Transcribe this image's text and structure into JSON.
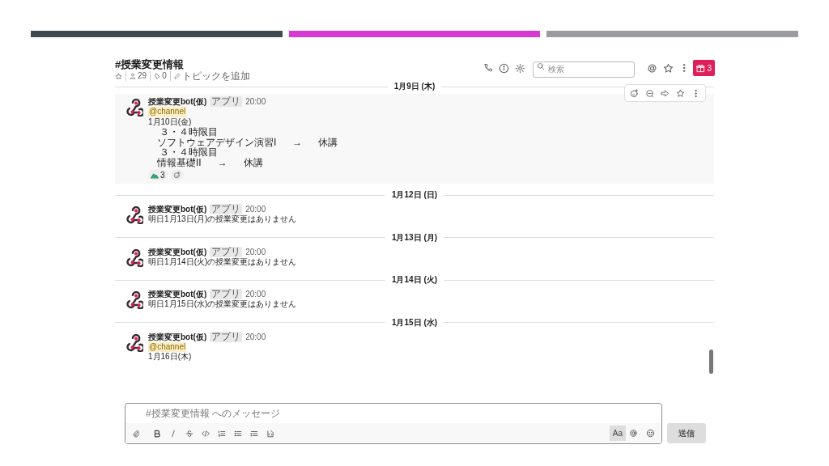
{
  "channel": {
    "name": "#授業変更情報",
    "member_count": "29",
    "pin_count": "0",
    "topic_action": "トピックを追加"
  },
  "search": {
    "placeholder": "検索"
  },
  "gift_badge": "3",
  "days": [
    {
      "date": "1月9日 (木)",
      "messages": [
        {
          "sender": "授業変更bot(仮)",
          "badge": "アプリ",
          "time": "20:00",
          "hovered": true,
          "lines": [
            {
              "kind": "mention",
              "text": "@channel"
            },
            {
              "kind": "text",
              "text": "1月10日(金)"
            },
            {
              "kind": "indent",
              "text": " ３・４時限目"
            },
            {
              "kind": "indent",
              "text": "ソフトウェアデザイン演習I      →      休講"
            },
            {
              "kind": "indent",
              "text": " ３・４時限目"
            },
            {
              "kind": "indent",
              "text": "情報基礎II      →      休講"
            }
          ],
          "reactions": [
            {
              "count": "3"
            }
          ]
        }
      ]
    },
    {
      "date": "1月12日 (日)",
      "messages": [
        {
          "sender": "授業変更bot(仮)",
          "badge": "アプリ",
          "time": "20:00",
          "hovered": false,
          "lines": [
            {
              "kind": "text",
              "text": "明日1月13日(月)の授業変更はありません"
            }
          ]
        }
      ]
    },
    {
      "date": "1月13日 (月)",
      "messages": [
        {
          "sender": "授業変更bot(仮)",
          "badge": "アプリ",
          "time": "20:00",
          "hovered": false,
          "lines": [
            {
              "kind": "text",
              "text": "明日1月14日(火)の授業変更はありません"
            }
          ]
        }
      ]
    },
    {
      "date": "1月14日 (火)",
      "messages": [
        {
          "sender": "授業変更bot(仮)",
          "badge": "アプリ",
          "time": "20:00",
          "hovered": false,
          "lines": [
            {
              "kind": "text",
              "text": "明日1月15日(水)の授業変更はありません"
            }
          ]
        }
      ]
    },
    {
      "date": "1月15日 (水)",
      "messages": [
        {
          "sender": "授業変更bot(仮)",
          "badge": "アプリ",
          "time": "20:00",
          "hovered": false,
          "lines": [
            {
              "kind": "mention",
              "text": "@channel"
            },
            {
              "kind": "text",
              "text": "1月16日(木)"
            }
          ]
        }
      ]
    }
  ],
  "composer": {
    "placeholder": "#授業変更情報 へのメッセージ",
    "format_button": "Aa",
    "format_selected": true,
    "send_button": "送信"
  }
}
